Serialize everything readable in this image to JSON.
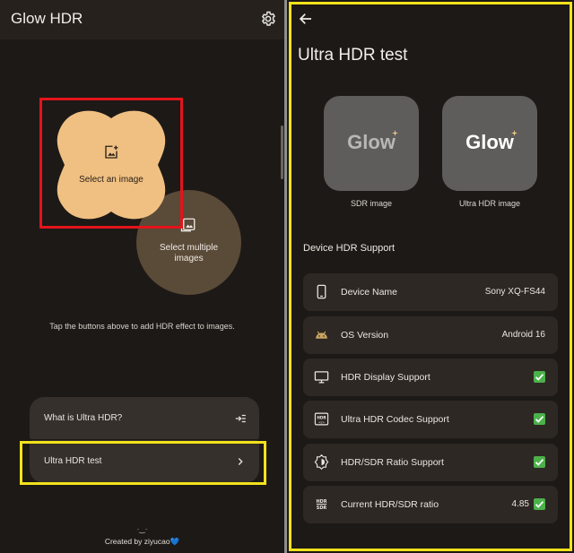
{
  "left": {
    "app_title": "Glow HDR",
    "settings_icon": "gear-icon",
    "select_image_label": "Select an image",
    "select_multiple_label_line1": "Select multiple",
    "select_multiple_label_line2": "images",
    "hint": "Tap the buttons above to add HDR effect to images.",
    "menu": [
      {
        "label": "What is Ultra HDR?",
        "icon": "expand-icon"
      },
      {
        "label": "Ultra HDR test",
        "icon": "chevron-right-icon"
      }
    ],
    "footer_dots": "·‿·",
    "footer_text": "Created by ziyucao",
    "footer_heart": "💙"
  },
  "right": {
    "screen_title": "Ultra HDR test",
    "thumbs": [
      {
        "word": "Glow",
        "label": "SDR image"
      },
      {
        "word": "Glow",
        "label": "Ultra HDR image"
      }
    ],
    "section_title": "Device HDR Support",
    "rows": [
      {
        "label": "Device Name",
        "value": "Sony XQ-FS44",
        "icon": "phone-icon",
        "check": false
      },
      {
        "label": "OS Version",
        "value": "Android 16",
        "icon": "android-icon",
        "check": false
      },
      {
        "label": "HDR Display Support",
        "value": "",
        "icon": "monitor-icon",
        "check": true
      },
      {
        "label": "Ultra HDR Codec Support",
        "value": "",
        "icon": "hdr-codec-icon",
        "check": true
      },
      {
        "label": "HDR/SDR Ratio Support",
        "value": "",
        "icon": "brightness-icon",
        "check": true
      },
      {
        "label": "Current HDR/SDR ratio",
        "value": "4.85",
        "icon": "hdr-sdr-icon",
        "check": true
      }
    ]
  },
  "colors": {
    "background": "#1d1916",
    "accent_blob": "#f0c082",
    "highlight_red": "#e4141b",
    "highlight_yellow": "#f2e21c",
    "check_green": "#4cb14a"
  }
}
